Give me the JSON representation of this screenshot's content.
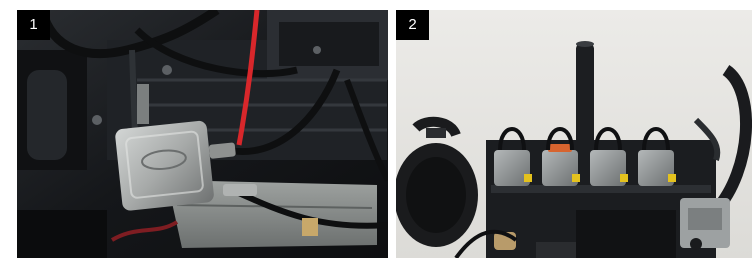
{
  "panels": [
    {
      "label": "1",
      "subject": "engine-close-up-connector",
      "colors": {
        "background": "#14161a",
        "engine": "#1f2226",
        "connector": "#a7aaa9",
        "red_wire": "#d8272b",
        "hose": "#0e0f10"
      }
    },
    {
      "label": "2",
      "subject": "engine-side-view-injectors",
      "colors": {
        "background": "#e4e3df",
        "engine": "#1b1d20",
        "injector": "#8f9394",
        "accent": "#e4c21e",
        "orange_cap": "#d7642f"
      }
    }
  ]
}
